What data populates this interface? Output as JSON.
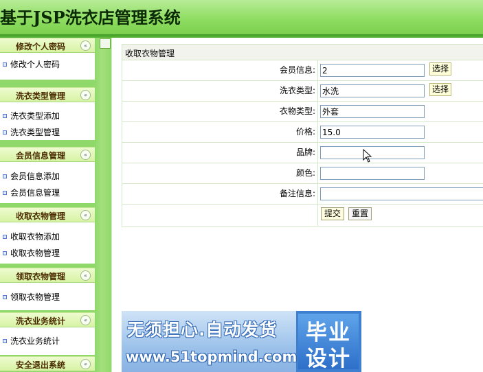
{
  "header": {
    "title": "基于JSP洗衣店管理系统"
  },
  "sidebar": {
    "groups": [
      {
        "title": "修改个人密码",
        "items": [
          "修改个人密码"
        ]
      },
      {
        "title": "洗衣类型管理",
        "items": [
          "洗衣类型添加",
          "洗衣类型管理"
        ]
      },
      {
        "title": "会员信息管理",
        "items": [
          "会员信息添加",
          "会员信息管理"
        ]
      },
      {
        "title": "收取衣物管理",
        "items": [
          "收取衣物添加",
          "收取衣物管理"
        ]
      },
      {
        "title": "领取衣物管理",
        "items": [
          "领取衣物管理"
        ]
      },
      {
        "title": "洗衣业务统计",
        "items": [
          "洗衣业务统计"
        ]
      },
      {
        "title": "安全退出系统",
        "items": []
      }
    ],
    "collapse_glyph": "«"
  },
  "form": {
    "title": "收取衣物管理",
    "fields": [
      {
        "label": "会员信息:",
        "value": "2",
        "pick": "选择"
      },
      {
        "label": "洗衣类型:",
        "value": "水洗",
        "pick": "选择"
      },
      {
        "label": "衣物类型:",
        "value": "外套"
      },
      {
        "label": "价格:",
        "value": "15.0"
      },
      {
        "label": "品牌:",
        "value": ""
      },
      {
        "label": "颜色:",
        "value": ""
      },
      {
        "label": "备注信息:",
        "value": ""
      }
    ],
    "submit_label": "提交",
    "reset_label": "重置"
  },
  "banner": {
    "slogan": "无须担心.自动发货",
    "url": "www.51topmind.com",
    "badge_line1": "毕业",
    "badge_line2": "设计"
  },
  "colors": {
    "header_green": "#8fdd62",
    "sidebar_green": "#8fd86a",
    "group_head": "#d7f3a4",
    "banner_blue": "#3f7fcf"
  }
}
